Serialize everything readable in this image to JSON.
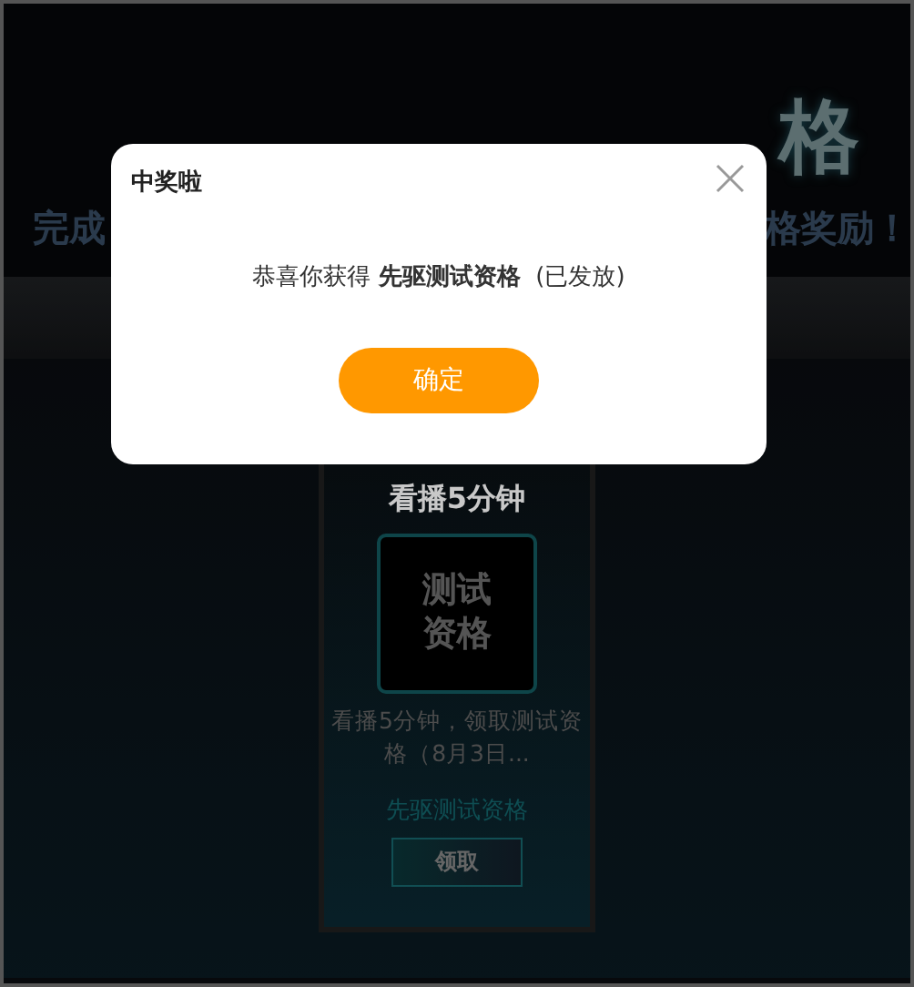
{
  "banner": {
    "heading": "格",
    "subtitle_left": "完成",
    "subtitle_right": "格奖励！"
  },
  "task_card": {
    "title": "看播5分钟",
    "reward_tile": "测试资格",
    "description": "看播5分钟，领取测试资格（8月3日...",
    "reward_name": "先驱测试资格",
    "claim_button": "领取"
  },
  "dialog": {
    "title": "中奖啦",
    "message_prefix": "恭喜你获得",
    "prize": "先驱测试资格",
    "message_suffix": "(已发放)",
    "confirm_button": "确定"
  }
}
